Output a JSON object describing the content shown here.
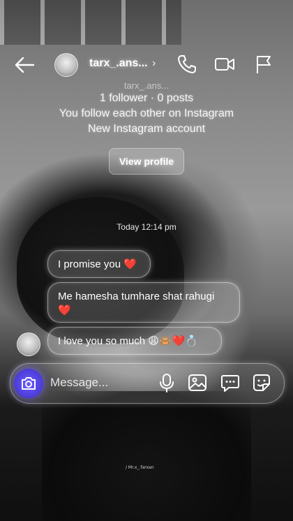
{
  "header": {
    "username": "tarx_.ans...",
    "chevron": "›",
    "icons": [
      "back-arrow-icon",
      "phone-icon",
      "video-camera-icon",
      "flag-icon"
    ]
  },
  "profile": {
    "faded_handle": "tarx_.ans...",
    "followers_posts": "1 follower · 0 posts",
    "mutual_follow": "You follow each other on Instagram",
    "account_note": "New Instagram account",
    "view_profile_label": "View profile"
  },
  "conversation": {
    "timestamp": "Today 12:14 pm",
    "messages": [
      {
        "text": "I promise you",
        "emoji": "❤️"
      },
      {
        "text": "Me hamesha tumhare shat rahugi",
        "emoji": "❤️"
      },
      {
        "text": "I love you so much",
        "emoji": "😩🙈❤️💍"
      }
    ]
  },
  "composer": {
    "placeholder": "Message...",
    "icons": [
      "camera-icon",
      "microphone-icon",
      "gallery-icon",
      "chat-bubble-icon",
      "sticker-icon"
    ]
  },
  "watermark": "/ Mr.x_.farxan",
  "colors": {
    "accent_camera": "#4a3bd6",
    "heart": "#ff3b45"
  }
}
